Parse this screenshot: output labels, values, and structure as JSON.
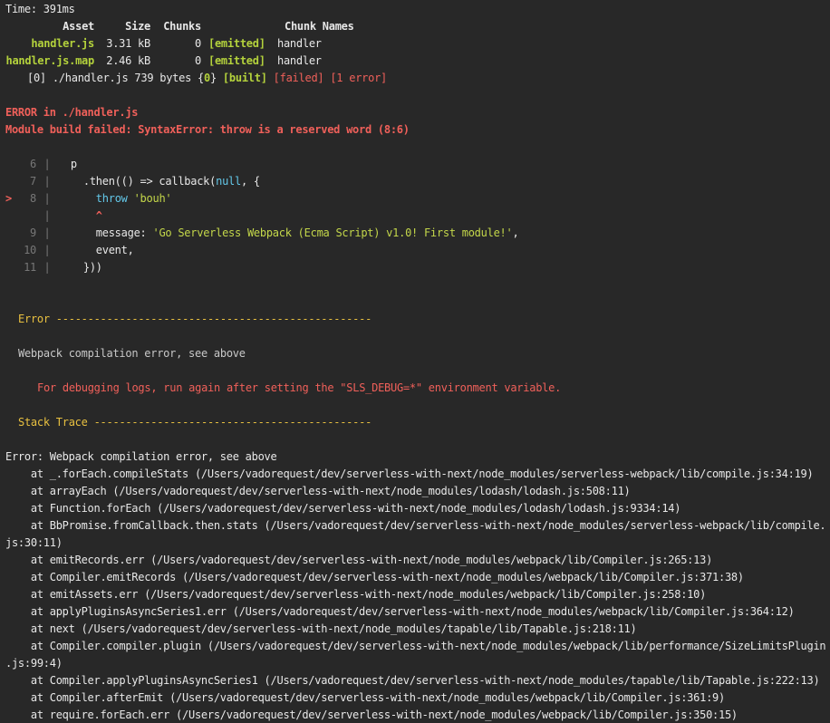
{
  "time_line": "Time: 391ms",
  "assets_table": {
    "headers": {
      "asset": "Asset",
      "size": "Size",
      "chunks": "Chunks",
      "chunk_names": "Chunk Names"
    },
    "rows": [
      {
        "asset": "handler.js",
        "size": "3.31 kB",
        "chunks": "0",
        "emitted": "[emitted]",
        "chunk_name": "handler"
      },
      {
        "asset": "handler.js.map",
        "size": "2.46 kB",
        "chunks": "0",
        "emitted": "[emitted]",
        "chunk_name": "handler"
      }
    ],
    "module_line": {
      "prefix": "[0] ./handler.js 739 bytes {",
      "chunk_id": "0",
      "suffix": "}",
      "built": "[built]",
      "failed": "[failed]",
      "errors": "[1 error]"
    }
  },
  "error": {
    "header": "ERROR in ./handler.js",
    "message": "Module build failed: SyntaxError: throw is a reserved word (8:6)"
  },
  "code_frame": [
    {
      "marker": "",
      "num": "6",
      "code": "  p"
    },
    {
      "marker": "",
      "num": "7",
      "code": "    .then(() => callback(null, {"
    },
    {
      "marker": ">",
      "num": "8",
      "code": "      throw 'bouh'"
    },
    {
      "marker": "",
      "num": "",
      "code": "      ^"
    },
    {
      "marker": "",
      "num": "9",
      "code": "      message: 'Go Serverless Webpack (Ecma Script) v1.0! First module!',"
    },
    {
      "marker": "",
      "num": "10",
      "code": "      event,"
    },
    {
      "marker": "",
      "num": "11",
      "code": "    }))"
    }
  ],
  "serverless_error": {
    "title": "Error",
    "rule": "--------------------------------------------------",
    "message": "Webpack compilation error, see above",
    "debug_hint": "For debugging logs, run again after setting the \"SLS_DEBUG=*\" environment variable."
  },
  "stack_trace": {
    "title": "Stack Trace",
    "rule": "--------------------------------------------",
    "error_line": "Error: Webpack compilation error, see above",
    "frames": [
      "    at _.forEach.compileStats (/Users/vadorequest/dev/serverless-with-next/node_modules/serverless-webpack/lib/compile.js:34:19)",
      "    at arrayEach (/Users/vadorequest/dev/serverless-with-next/node_modules/lodash/lodash.js:508:11)",
      "    at Function.forEach (/Users/vadorequest/dev/serverless-with-next/node_modules/lodash/lodash.js:9334:14)",
      "    at BbPromise.fromCallback.then.stats (/Users/vadorequest/dev/serverless-with-next/node_modules/serverless-webpack/lib/compile.",
      "js:30:11)",
      "    at emitRecords.err (/Users/vadorequest/dev/serverless-with-next/node_modules/webpack/lib/Compiler.js:265:13)",
      "    at Compiler.emitRecords (/Users/vadorequest/dev/serverless-with-next/node_modules/webpack/lib/Compiler.js:371:38)",
      "    at emitAssets.err (/Users/vadorequest/dev/serverless-with-next/node_modules/webpack/lib/Compiler.js:258:10)",
      "    at applyPluginsAsyncSeries1.err (/Users/vadorequest/dev/serverless-with-next/node_modules/webpack/lib/Compiler.js:364:12)",
      "    at next (/Users/vadorequest/dev/serverless-with-next/node_modules/tapable/lib/Tapable.js:218:11)",
      "    at Compiler.compiler.plugin (/Users/vadorequest/dev/serverless-with-next/node_modules/webpack/lib/performance/SizeLimitsPlugin",
      ".js:99:4)",
      "    at Compiler.applyPluginsAsyncSeries1 (/Users/vadorequest/dev/serverless-with-next/node_modules/tapable/lib/Tapable.js:222:13)",
      "    at Compiler.afterEmit (/Users/vadorequest/dev/serverless-with-next/node_modules/webpack/lib/Compiler.js:361:9)",
      "    at require.forEach.err (/Users/vadorequest/dev/serverless-with-next/node_modules/webpack/lib/Compiler.js:350:15)"
    ]
  },
  "colors": {
    "background": "#282828",
    "text": "#e8e8e8",
    "green": "#b4d23c",
    "red": "#f0605a",
    "yellow": "#e8c040",
    "gray": "#777777"
  }
}
